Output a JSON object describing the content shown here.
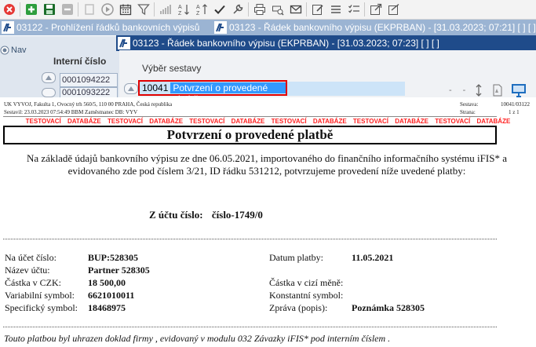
{
  "toolbar": {
    "icons": [
      "close-icon",
      "add-icon",
      "save-icon",
      "delete-icon",
      "copy-icon",
      "play-icon",
      "calendar-icon",
      "filter-icon",
      "bar-chart-icon",
      "sort-asc-icon",
      "sort-desc-icon",
      "check-icon",
      "wrench-icon",
      "print-icon",
      "print-preview-icon",
      "mail-icon",
      "edit-icon",
      "list-icon",
      "checklist-icon",
      "external-link-icon",
      "export-icon"
    ]
  },
  "windows": {
    "back_title": "03122 - Prohlížení řádků bankovních výpisů",
    "middle_title": "03123 - Řádek bankovního výpisu (EKPRBAN) - [31.03.2023; 07:21]  [ ]  [ ]",
    "front_title": "03123 - Řádek bankovního výpisu (EKPRBAN) - [31.03.2023; 07:23]  [ ]  [ ]"
  },
  "background_form": {
    "nav_label": "Nav",
    "interni_label": "Interní číslo",
    "values": [
      "0001094222",
      "0001093222"
    ]
  },
  "dialog": {
    "section_label": "Výběr sestavy",
    "report_code": "10041",
    "report_name": "Potvrzení o provedené platbě"
  },
  "report": {
    "org_line": "UK VYVOJ, Fakulta 1, Ovocný trh 560/5, 110 00 PRAHA, Česká republika",
    "created_line": "Sestavil: 23.03.2023 07:54:49 BBM Zaměstnanec  DB: VYV",
    "sestava_label": "Sestava:",
    "sestava_value": "10041/03122",
    "strana_label": "Strana:",
    "strana_value": "1 z 1",
    "test_db": "TESTOVACÍ DATABÁZE",
    "title": "Potvrzení o provedené platbě",
    "intro_line1": "Na základě údajů bankovního výpisu ze dne 06.05.2021, importovaného do finančního informačního systému iFIS* a",
    "intro_line2": "evidovaného zde pod číslem 3/21, ID řádku 531212, potvrzujeme provedení níže uvedené platby:",
    "from_account_label": "Z účtu číslo:",
    "from_account_value": "číslo-1749/0",
    "left_fields": [
      {
        "label": "Na účet číslo:",
        "value": "BUP:528305"
      },
      {
        "label": "Název účtu:",
        "value": "Partner 528305"
      },
      {
        "label": "Částka v CZK:",
        "value": "18 500,00"
      },
      {
        "label": "Variabilní symbol:",
        "value": "6621010011"
      },
      {
        "label": "Specifický symbol:",
        "value": "18468975"
      }
    ],
    "right_fields": [
      {
        "label": "Datum platby:",
        "value": "11.05.2021"
      },
      {
        "label": "",
        "value": ""
      },
      {
        "label": "Částka v cizí měně:",
        "value": ""
      },
      {
        "label": "Konstantní symbol:",
        "value": ""
      },
      {
        "label": "Zpráva (popis):",
        "value": "Poznámka 528305"
      }
    ],
    "footer": "Touto platbou byl uhrazen doklad firmy , evidovaný v modulu 032 Závazky iFIS* pod interním číslem ."
  },
  "colors": {
    "titlebar_back": "#9bb4d3",
    "titlebar_front": "#1f4b8a",
    "selection": "#3399ff",
    "highlight_border": "#e00000",
    "test_db_red": "#ff2020"
  }
}
